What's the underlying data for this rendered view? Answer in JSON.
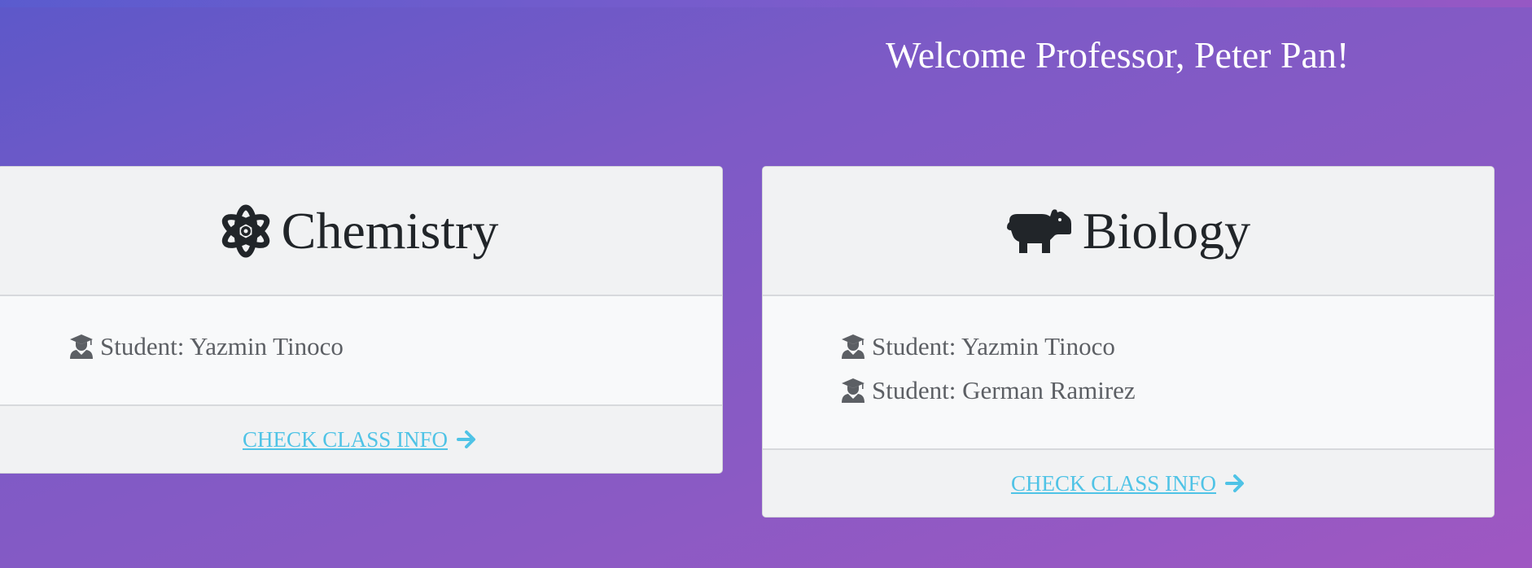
{
  "header": {
    "welcome": "Welcome Professor, Peter Pan!"
  },
  "classes": [
    {
      "name": "Chemistry",
      "icon": "atom-icon",
      "students": [
        "Student: Yazmin Tinoco"
      ],
      "link_label": "CHECK CLASS INFO"
    },
    {
      "name": "Biology",
      "icon": "hippo-icon",
      "students": [
        "Student: Yazmin Tinoco",
        "Student: German Ramirez"
      ],
      "link_label": "CHECK CLASS INFO"
    }
  ],
  "colors": {
    "link": "#4fc3e6",
    "title": "#212529",
    "student_text": "#5c5f64",
    "background_start": "#5d58c9",
    "background_end": "#9f57c2"
  }
}
